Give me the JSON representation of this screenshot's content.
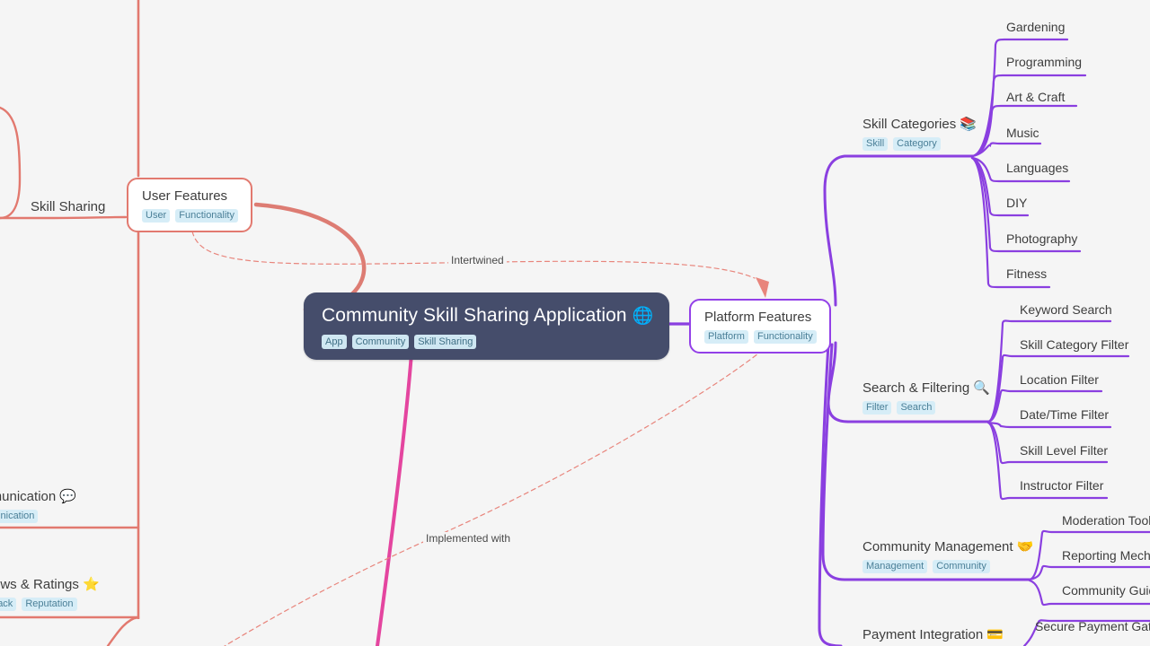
{
  "diagram": {
    "type": "mindmap",
    "background": "#f5f5f5",
    "root": {
      "title": "Community Skill Sharing Application",
      "icon": "globe-icon",
      "icon_glyph": "🌐",
      "tags": [
        "App",
        "Community",
        "Skill Sharing"
      ],
      "color": "#454d6b"
    },
    "branches": [
      {
        "id": "user-features",
        "title": "User Features",
        "tags": [
          "User",
          "Functionality"
        ],
        "color": "#e2796f",
        "style": "boxed"
      },
      {
        "id": "platform-features",
        "title": "Platform Features",
        "tags": [
          "Platform",
          "Functionality"
        ],
        "color": "#9340e8",
        "style": "boxed"
      }
    ],
    "user_children": [
      {
        "id": "skill-sharing",
        "title": "Skill Sharing",
        "icon": "",
        "icon_glyph": "",
        "tags": [],
        "color": "#e2796f"
      },
      {
        "id": "communication",
        "title": "Communication",
        "icon": "speech-balloon-icon",
        "icon_glyph": "💬",
        "tags": [
          "Communication"
        ],
        "color": "#e2796f"
      },
      {
        "id": "reviews-ratings",
        "title": "Reviews & Ratings",
        "icon": "star-icon",
        "icon_glyph": "⭐",
        "tags": [
          "Feedback",
          "Reputation"
        ],
        "color": "#e2796f"
      }
    ],
    "platform_children": [
      {
        "id": "skill-categories",
        "title": "Skill Categories",
        "icon": "books-icon",
        "icon_glyph": "📚",
        "tags": [
          "Skill",
          "Category"
        ],
        "color": "#9340e8",
        "leaves": [
          "Gardening",
          "Programming",
          "Art & Craft",
          "Music",
          "Languages",
          "DIY",
          "Photography",
          "Fitness"
        ]
      },
      {
        "id": "search-filtering",
        "title": "Search & Filtering",
        "icon": "magnifying-glass-icon",
        "icon_glyph": "🔍",
        "tags": [
          "Filter",
          "Search"
        ],
        "color": "#9340e8",
        "leaves": [
          "Keyword Search",
          "Skill Category Filter",
          "Location Filter",
          "Date/Time Filter",
          "Skill Level Filter",
          "Instructor Filter"
        ]
      },
      {
        "id": "community-management",
        "title": "Community Management",
        "icon": "handshake-icon",
        "icon_glyph": "🤝",
        "tags": [
          "Management",
          "Community"
        ],
        "color": "#9340e8",
        "leaves": [
          "Moderation Tools",
          "Reporting Mechanisms",
          "Community Guidelines"
        ]
      },
      {
        "id": "payment-integration",
        "title": "Payment Integration",
        "icon": "credit-card-icon",
        "icon_glyph": "💳",
        "tags": [],
        "color": "#9340e8",
        "leaves": [
          "Secure Payment Gateway"
        ]
      }
    ],
    "cross_links": [
      {
        "id": "intertwined",
        "label": "Intertwined",
        "color": "#e8857c",
        "style": "dashed"
      },
      {
        "id": "implemented-with",
        "label": "Implemented with",
        "color": "#e8857c",
        "style": "dashed"
      }
    ]
  }
}
